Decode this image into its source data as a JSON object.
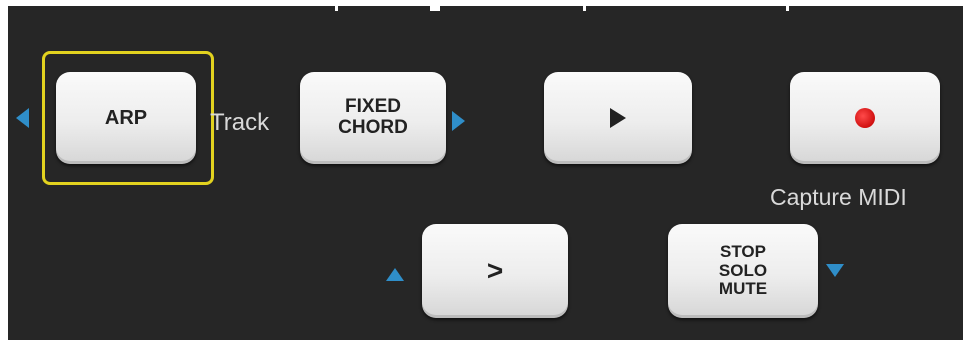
{
  "buttons": {
    "arp": {
      "label": "ARP"
    },
    "fixed_chord": {
      "line1": "FIXED",
      "line2": "CHORD"
    },
    "play": {
      "icon": "play-icon"
    },
    "record": {
      "icon": "record-icon"
    },
    "next": {
      "label": ">"
    },
    "stop_solo_mute": {
      "line1": "STOP",
      "line2": "SOLO",
      "line3": "MUTE"
    }
  },
  "labels": {
    "track": "Track",
    "capture_midi": "Capture MIDI"
  },
  "colors": {
    "panel": "#262626",
    "arrow_accent": "#2f8ec9",
    "highlight": "#e2d21f",
    "record": "#d01010"
  },
  "arrows": [
    "arrow-left-icon",
    "arrow-right-icon",
    "arrow-up-icon",
    "arrow-down-icon"
  ]
}
